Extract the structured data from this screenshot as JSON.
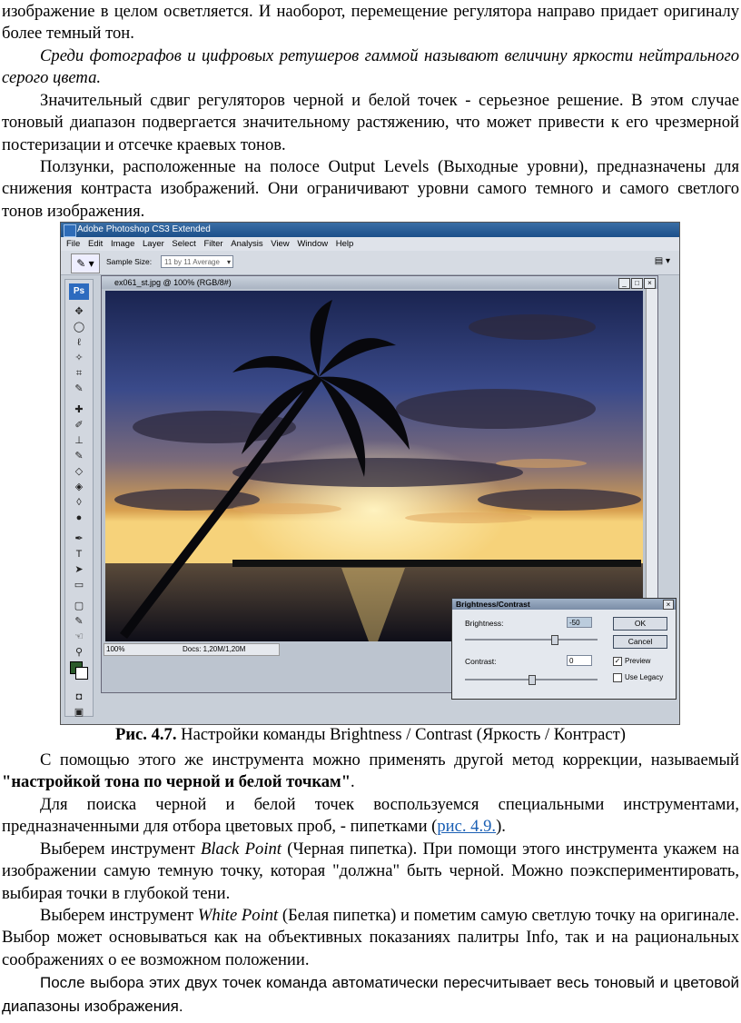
{
  "paragraphs": {
    "p1": "изображение в целом осветляется. И наоборот, перемещение регулятора направо придает оригиналу более темный тон.",
    "p2": "Среди фотографов и цифровых ретушеров гаммой называют величину яркости нейтрального серого цвета.",
    "p3": "Значительный сдвиг регуляторов черной и белой точек - серьезное решение. В этом случае тоновый диапазон подвергается значительному растяжению, что может привести к его чрезмерной постеризации и отсечке краевых тонов.",
    "p4": "Ползунки, расположенные на полосе Output Levels (Выходные уровни), предназначены для снижения контраста изображений. Они ограничивают уровни самого темного и самого светлого тонов изображения."
  },
  "figure": {
    "caption_num": "Рис. 4.7.",
    "caption_text": " Настройки команды Brightness / Contrast (Яркость / Контраст)",
    "app_title": "Adobe Photoshop CS3 Extended",
    "menu": [
      "File",
      "Edit",
      "Image",
      "Layer",
      "Select",
      "Filter",
      "Analysis",
      "View",
      "Window",
      "Help"
    ],
    "sample_size_label": "Sample Size:",
    "sample_size_value": "11 by 11 Average",
    "ps_logo": "Ps",
    "doc_title": "ex061_st.jpg @ 100% (RGB/8#)",
    "zoom": "100%",
    "doc_size": "Docs: 1,20M/1,20M",
    "dialog": {
      "title": "Brightness/Contrast",
      "brightness_label": "Brightness:",
      "brightness_value": "-50",
      "contrast_label": "Contrast:",
      "contrast_value": "0",
      "ok": "OK",
      "cancel": "Cancel",
      "preview": "Preview",
      "preview_checked": true,
      "legacy": "Use Legacy",
      "legacy_checked": false,
      "brightness_level": 0.67,
      "contrast_level": 0.5
    }
  },
  "after": {
    "p5_a": "С помощью этого же инструмента можно применять другой метод коррекции, называемый ",
    "p5_b": "\"настройкой тона по черной и белой точкам\"",
    "p5_c": ".",
    "p6_a": "Для поиска черной и белой точек воспользуемся специальными инструментами, предназначенными для отбора цветовых проб, - пипетками (",
    "p6_link": "рис. 4.9.",
    "p6_c": ").",
    "p7_a": "Выберем инструмент ",
    "p7_i": "Black Point",
    "p7_c": " (Черная пипетка). При помощи этого инструмента укажем на изображении самую темную точку, которая \"должна\" быть черной. Можно поэкспериментировать, выбирая точки в глубокой тени.",
    "p8_a": "Выберем инструмент ",
    "p8_i": "White Point",
    "p8_c": " (Белая пипетка) и пометим самую светлую точку на оригинале. Выбор может основываться как на объективных показаниях палитры Info, так и на рациональных соображениях о ее возможном положении.",
    "p9": "После выбора этих двух точек команда автоматически пересчитывает весь тоновый и цветовой диапазоны изображения."
  }
}
